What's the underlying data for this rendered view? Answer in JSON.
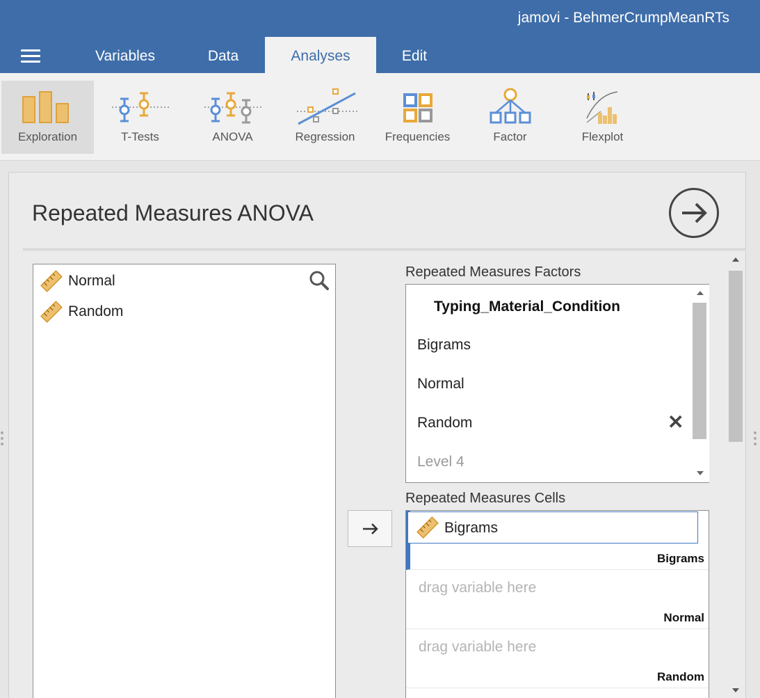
{
  "app": {
    "title": "jamovi - BehmerCrumpMeanRTs"
  },
  "tabs": [
    {
      "label": "Variables"
    },
    {
      "label": "Data"
    },
    {
      "label": "Analyses"
    },
    {
      "label": "Edit"
    }
  ],
  "active_tab": "Analyses",
  "ribbon": [
    {
      "label": "Exploration",
      "icon": "exploration-icon"
    },
    {
      "label": "T-Tests",
      "icon": "t-tests-icon"
    },
    {
      "label": "ANOVA",
      "icon": "anova-icon"
    },
    {
      "label": "Regression",
      "icon": "regression-icon"
    },
    {
      "label": "Frequencies",
      "icon": "frequencies-icon"
    },
    {
      "label": "Factor",
      "icon": "factor-icon"
    },
    {
      "label": "Flexplot",
      "icon": "flexplot-icon"
    }
  ],
  "analysis": {
    "title": "Repeated Measures ANOVA",
    "variables": [
      {
        "name": "Normal",
        "icon": "continuous-ruler-icon"
      },
      {
        "name": "Random",
        "icon": "continuous-ruler-icon"
      }
    ],
    "rm_factors": {
      "label": "Repeated Measures Factors",
      "factor_name": "Typing_Material_Condition",
      "levels": [
        "Bigrams",
        "Normal",
        "Random"
      ],
      "new_level_placeholder": "Level 4"
    },
    "rm_cells": {
      "label": "Repeated Measures Cells",
      "placeholder": "drag variable here",
      "cells": [
        {
          "level": "Bigrams",
          "variable": "Bigrams"
        },
        {
          "level": "Normal",
          "variable": null
        },
        {
          "level": "Random",
          "variable": null
        }
      ]
    }
  },
  "colors": {
    "header_blue": "#3e6da9",
    "accent_orange": "#e8a838",
    "selection_blue": "#3e78c2"
  }
}
